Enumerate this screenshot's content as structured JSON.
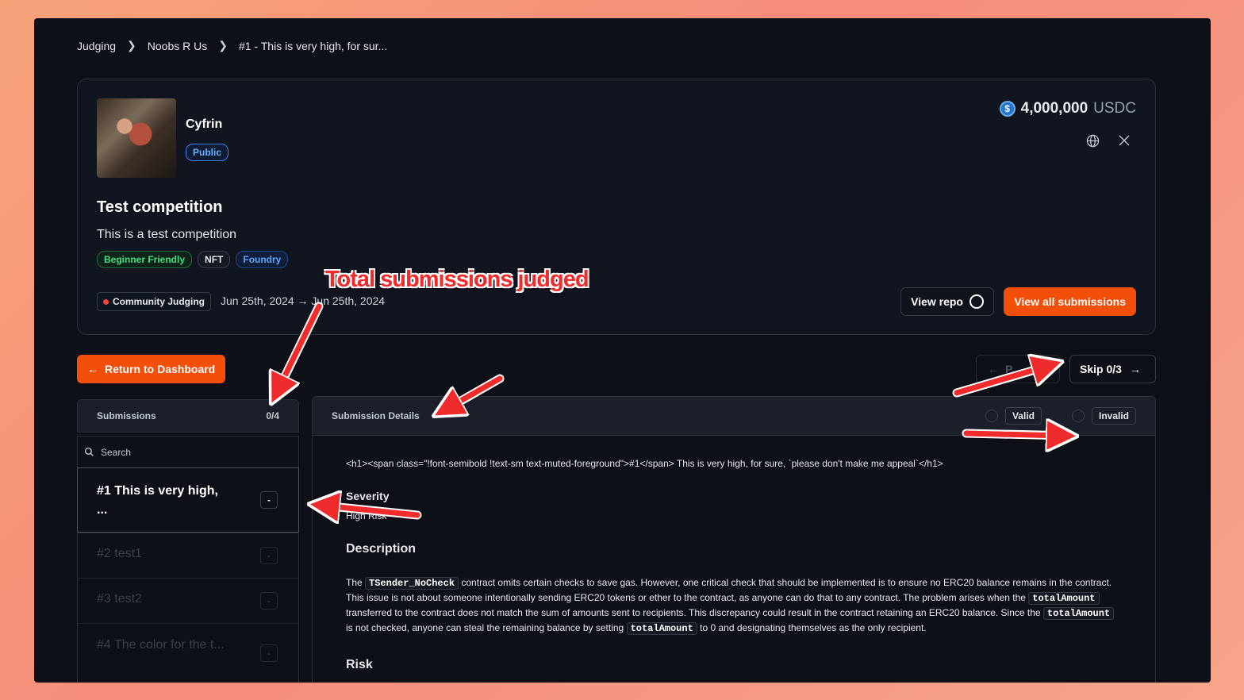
{
  "breadcrumb": [
    "Judging",
    "Noobs R Us",
    "#1 - This is very high, for sur..."
  ],
  "organization": {
    "name": "Cyfrin",
    "visibility": "Public"
  },
  "prize": {
    "amount": "4,000,000",
    "currency": "USDC"
  },
  "competition": {
    "title": "Test competition",
    "description": "This is a test competition",
    "tags": [
      "Beginner Friendly",
      "NFT",
      "Foundry"
    ],
    "judging_type": "Community Judging",
    "dates": "Jun 25th, 2024 → Jun 25th, 2024"
  },
  "buttons": {
    "view_repo": "View repo",
    "view_all": "View all submissions",
    "return": "Return to Dashboard",
    "prev": "P...",
    "skip": "Skip 0/3"
  },
  "submissions_panel": {
    "title": "Submissions",
    "count": "0/4",
    "search_placeholder": "Search",
    "items": [
      {
        "label": "#1 This is very high, ...",
        "status": "-"
      },
      {
        "label": "#2 test1",
        "status": "-"
      },
      {
        "label": "#3 test2",
        "status": "-"
      },
      {
        "label": "#4 The color for the t...",
        "status": "-"
      }
    ]
  },
  "details_panel": {
    "title": "Submission Details",
    "valid_label": "Valid",
    "invalid_label": "Invalid",
    "raw_heading": "<h1><span class=\"!font-semibold !text-sm text-muted-foreground\">#1</span> This is very high, for sure, `please don't make me appeal`</h1>",
    "severity_heading": "Severity",
    "severity_value": "High Risk",
    "description_heading": "Description",
    "desc": {
      "p1": "The ",
      "c1": "TSender_NoCheck",
      "p2": " contract omits certain checks to save gas. However, one critical check that should be implemented is to ensure no ERC20 balance remains in the contract. This issue is not about someone intentionally sending ERC20 tokens or ether to the contract, as anyone can do that to any contract. The problem arises when the ",
      "c2": "totalAmount",
      "p3": " transferred to the contract does not match the sum of amounts sent to recipients. This discrepancy could result in the contract retaining an ERC20 balance. Since the ",
      "c3": "totalAmount",
      "p4": " is not checked, anyone can steal the remaining balance by setting ",
      "c4": "totalAmount",
      "p5": " to 0 and designating themselves as the only recipient."
    },
    "risk_heading": "Risk"
  },
  "annotation": {
    "callout": "Total submissions judged"
  },
  "icons": {
    "globe": "globe-icon",
    "x": "x-logo-icon",
    "github": "github-icon",
    "search": "search-icon",
    "usdc": "usdc-icon"
  },
  "colors": {
    "accent": "#f24f0b",
    "annotation": "#ef2b2b"
  }
}
